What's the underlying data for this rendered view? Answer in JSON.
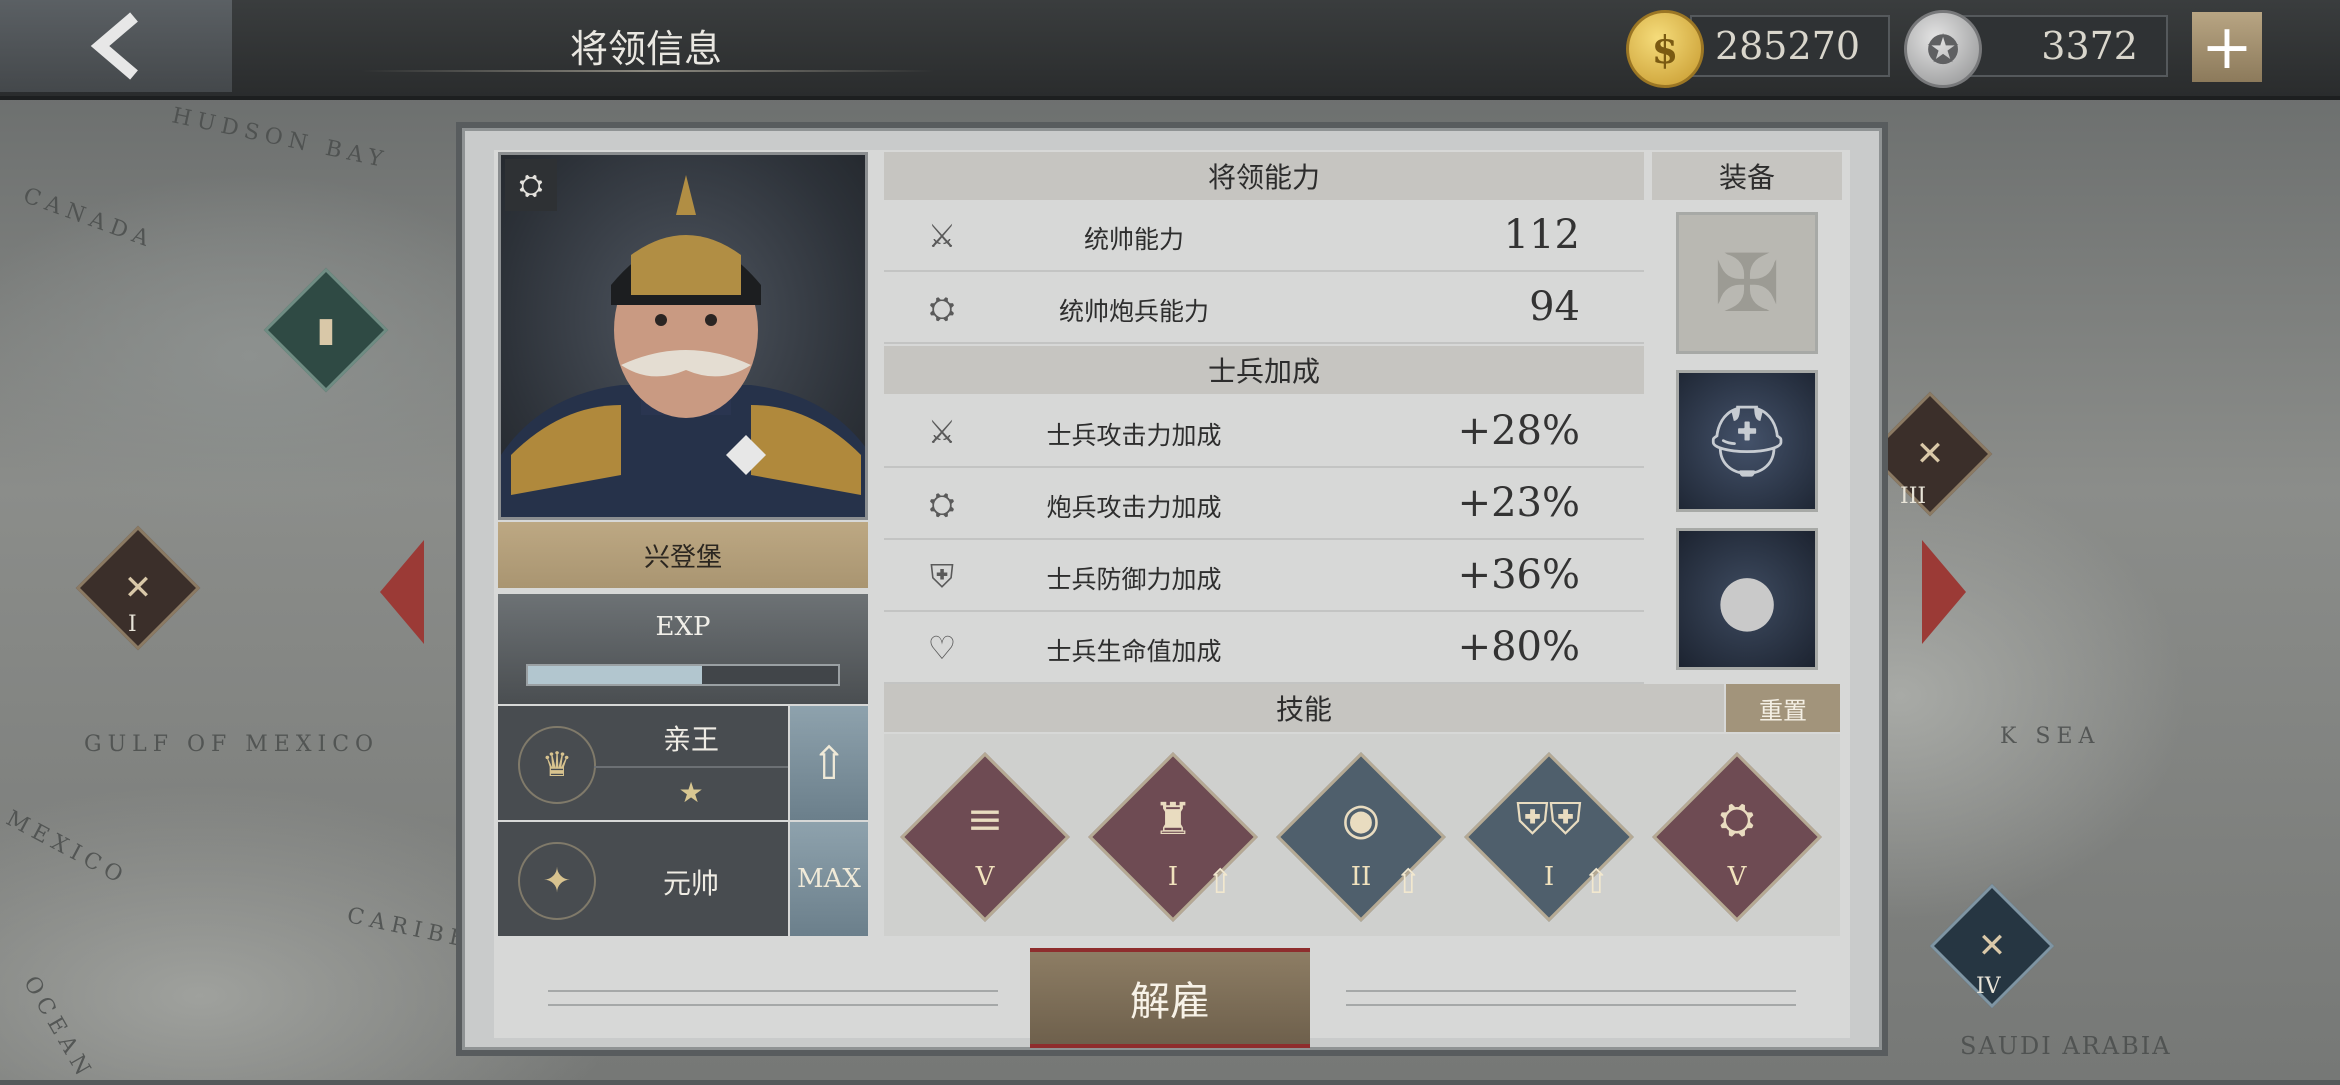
{
  "header": {
    "title": "将领信息"
  },
  "currency": {
    "gold": {
      "icon": "gold-coin-icon",
      "value": "285270"
    },
    "medals": {
      "icon": "silver-medal-icon",
      "value": "3372"
    },
    "add_label": "+"
  },
  "map": {
    "labels": [
      "HUDSON BAY",
      "CANADA",
      "GULF OF MEXICO",
      "MEXICO",
      "CARIBE",
      "OCEAN",
      "K SEA",
      "SAUDI ARABIA"
    ],
    "nodes": [
      {
        "roman": "I"
      },
      {
        "roman": "III"
      },
      {
        "roman": "IV"
      }
    ]
  },
  "general": {
    "name": "兴登堡",
    "exp_label": "EXP",
    "exp_fraction": 0.56,
    "title_rank": "亲王",
    "military_rank": "元帅",
    "max_label": "MAX",
    "stars": "★"
  },
  "abilities": {
    "header": "将领能力",
    "items": [
      {
        "icon": "crossed-swords-icon",
        "name": "统帅能力",
        "value": "112"
      },
      {
        "icon": "cannon-icon",
        "name": "统帅炮兵能力",
        "value": "94"
      }
    ]
  },
  "soldier_bonus": {
    "header": "士兵加成",
    "items": [
      {
        "icon": "swords-plus-icon",
        "name": "士兵攻击力加成",
        "value": "+28%"
      },
      {
        "icon": "cannon-plus-icon",
        "name": "炮兵攻击力加成",
        "value": "+23%"
      },
      {
        "icon": "shield-plus-icon",
        "name": "士兵防御力加成",
        "value": "+36%"
      },
      {
        "icon": "heart-plus-icon",
        "name": "士兵生命值加成",
        "value": "+80%"
      }
    ]
  },
  "equipment": {
    "header": "装备",
    "slots": [
      {
        "icon": "medal-cross-icon"
      },
      {
        "icon": "helmet-equipment-icon"
      },
      {
        "icon": "cannonball-bucket-icon"
      }
    ]
  },
  "skills": {
    "header": "技能",
    "reset_label": "重置",
    "items": [
      {
        "icon": "shells-icon",
        "level": "V",
        "upgradable": false,
        "color": "#6e4b53"
      },
      {
        "icon": "fortress-icon",
        "level": "I",
        "upgradable": true,
        "color": "#6e4b53"
      },
      {
        "icon": "eye-icon",
        "level": "II",
        "upgradable": true,
        "color": "#4f5f6c"
      },
      {
        "icon": "shields-icon",
        "level": "I",
        "upgradable": true,
        "color": "#4f5f6c"
      },
      {
        "icon": "laurel-cannon-icon",
        "level": "V",
        "upgradable": false,
        "color": "#6e4b53"
      }
    ]
  },
  "actions": {
    "dismiss_label": "解雇"
  },
  "colors": {
    "accent_red": "#8e2d2d",
    "gold": "#bda883"
  }
}
